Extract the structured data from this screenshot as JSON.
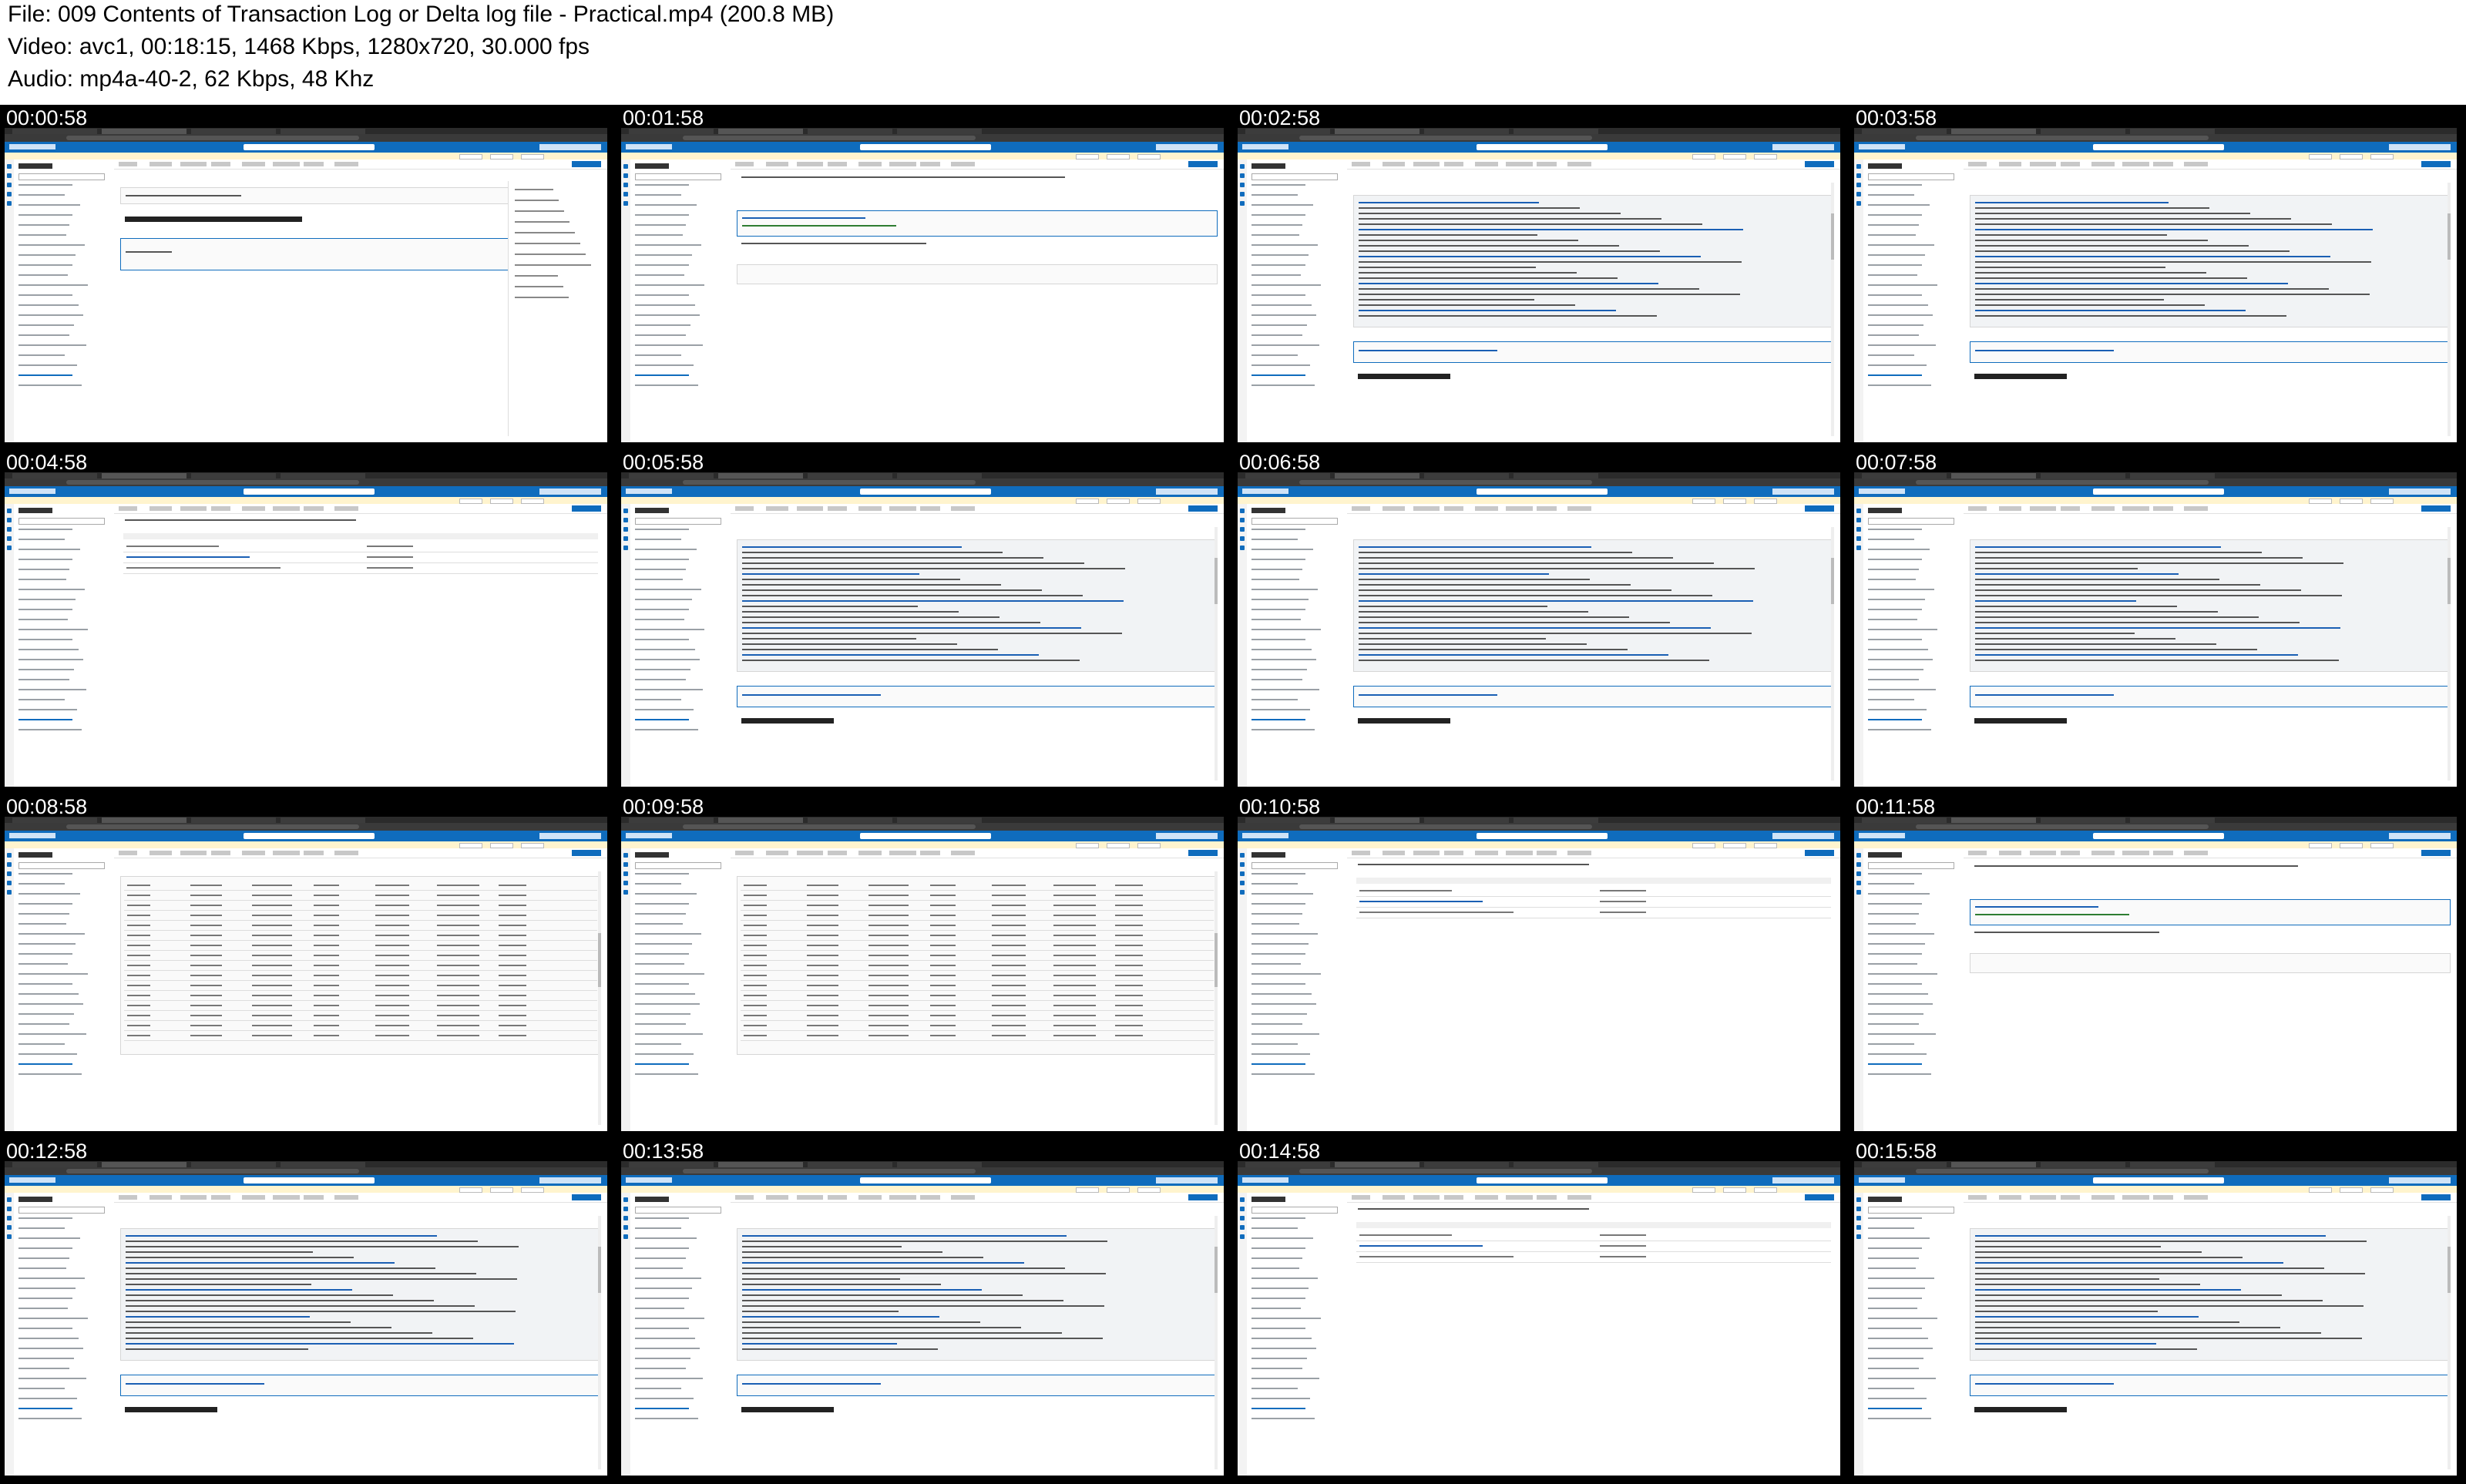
{
  "file_info": {
    "file_line": "File: 009 Contents of Transaction Log or Delta log file - Practical.mp4 (200.8 MB)",
    "video_line": "Video: avc1, 00:18:15, 1468 Kbps, 1280x720, 30.000 fps",
    "audio_line": "Audio: mp4a-40-2, 62 Kbps, 48 Khz"
  },
  "thumbnails": [
    {
      "timestamp": "00:00:58",
      "view": "markdown_intro"
    },
    {
      "timestamp": "00:01:58",
      "view": "code_cell"
    },
    {
      "timestamp": "00:02:58",
      "view": "json_output"
    },
    {
      "timestamp": "00:03:58",
      "view": "json_output"
    },
    {
      "timestamp": "00:04:58",
      "view": "file_browser"
    },
    {
      "timestamp": "00:05:58",
      "view": "json_output"
    },
    {
      "timestamp": "00:06:58",
      "view": "json_output"
    },
    {
      "timestamp": "00:07:58",
      "view": "json_output"
    },
    {
      "timestamp": "00:08:58",
      "view": "table_output"
    },
    {
      "timestamp": "00:09:58",
      "view": "table_output"
    },
    {
      "timestamp": "00:10:58",
      "view": "file_browser"
    },
    {
      "timestamp": "00:11:58",
      "view": "code_cell"
    },
    {
      "timestamp": "00:12:58",
      "view": "json_output"
    },
    {
      "timestamp": "00:13:58",
      "view": "json_output"
    },
    {
      "timestamp": "00:14:58",
      "view": "file_browser"
    },
    {
      "timestamp": "00:15:58",
      "view": "json_output"
    }
  ],
  "colors": {
    "azure_blue": "#0f6cbd",
    "grid_background": "#000000",
    "timestamp_text": "#ffffff"
  }
}
